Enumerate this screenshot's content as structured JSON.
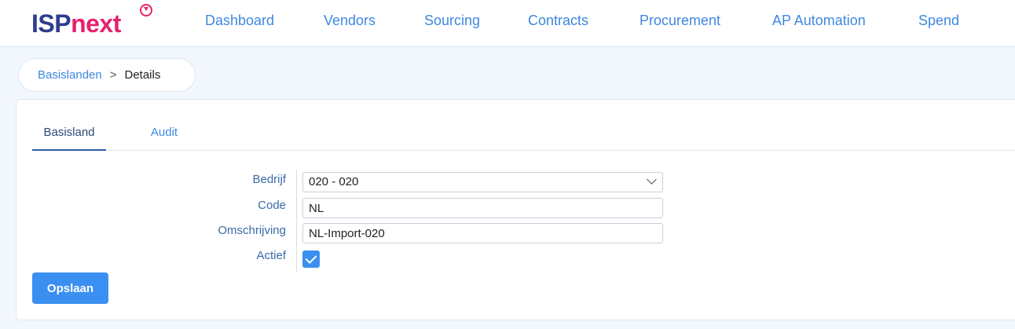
{
  "brand": {
    "part1": "ISP",
    "part2": "next"
  },
  "nav": {
    "items": [
      {
        "label": "Dashboard"
      },
      {
        "label": "Vendors"
      },
      {
        "label": "Sourcing"
      },
      {
        "label": "Contracts"
      },
      {
        "label": "Procurement"
      },
      {
        "label": "AP Automation"
      },
      {
        "label": "Spend"
      }
    ]
  },
  "breadcrumb": {
    "parent": "Basislanden",
    "separator": ">",
    "current": "Details"
  },
  "tabs": [
    {
      "label": "Basisland",
      "active": true
    },
    {
      "label": "Audit",
      "active": false
    }
  ],
  "form": {
    "bedrijf": {
      "label": "Bedrijf",
      "value": "020 - 020"
    },
    "code": {
      "label": "Code",
      "value": "NL"
    },
    "omschrijving": {
      "label": "Omschrijving",
      "value": "NL-Import-020"
    },
    "actief": {
      "label": "Actief",
      "checked": true
    }
  },
  "actions": {
    "save_label": "Opslaan"
  },
  "colors": {
    "accent": "#3a8ff0",
    "nav_link": "#3f88e0",
    "brand_dark": "#2d3e8f",
    "brand_pink": "#e5226d"
  },
  "icons": {
    "dropdown": "chevron-down-icon",
    "checkbox": "check-icon",
    "logo_badge": "heart-badge-icon"
  }
}
